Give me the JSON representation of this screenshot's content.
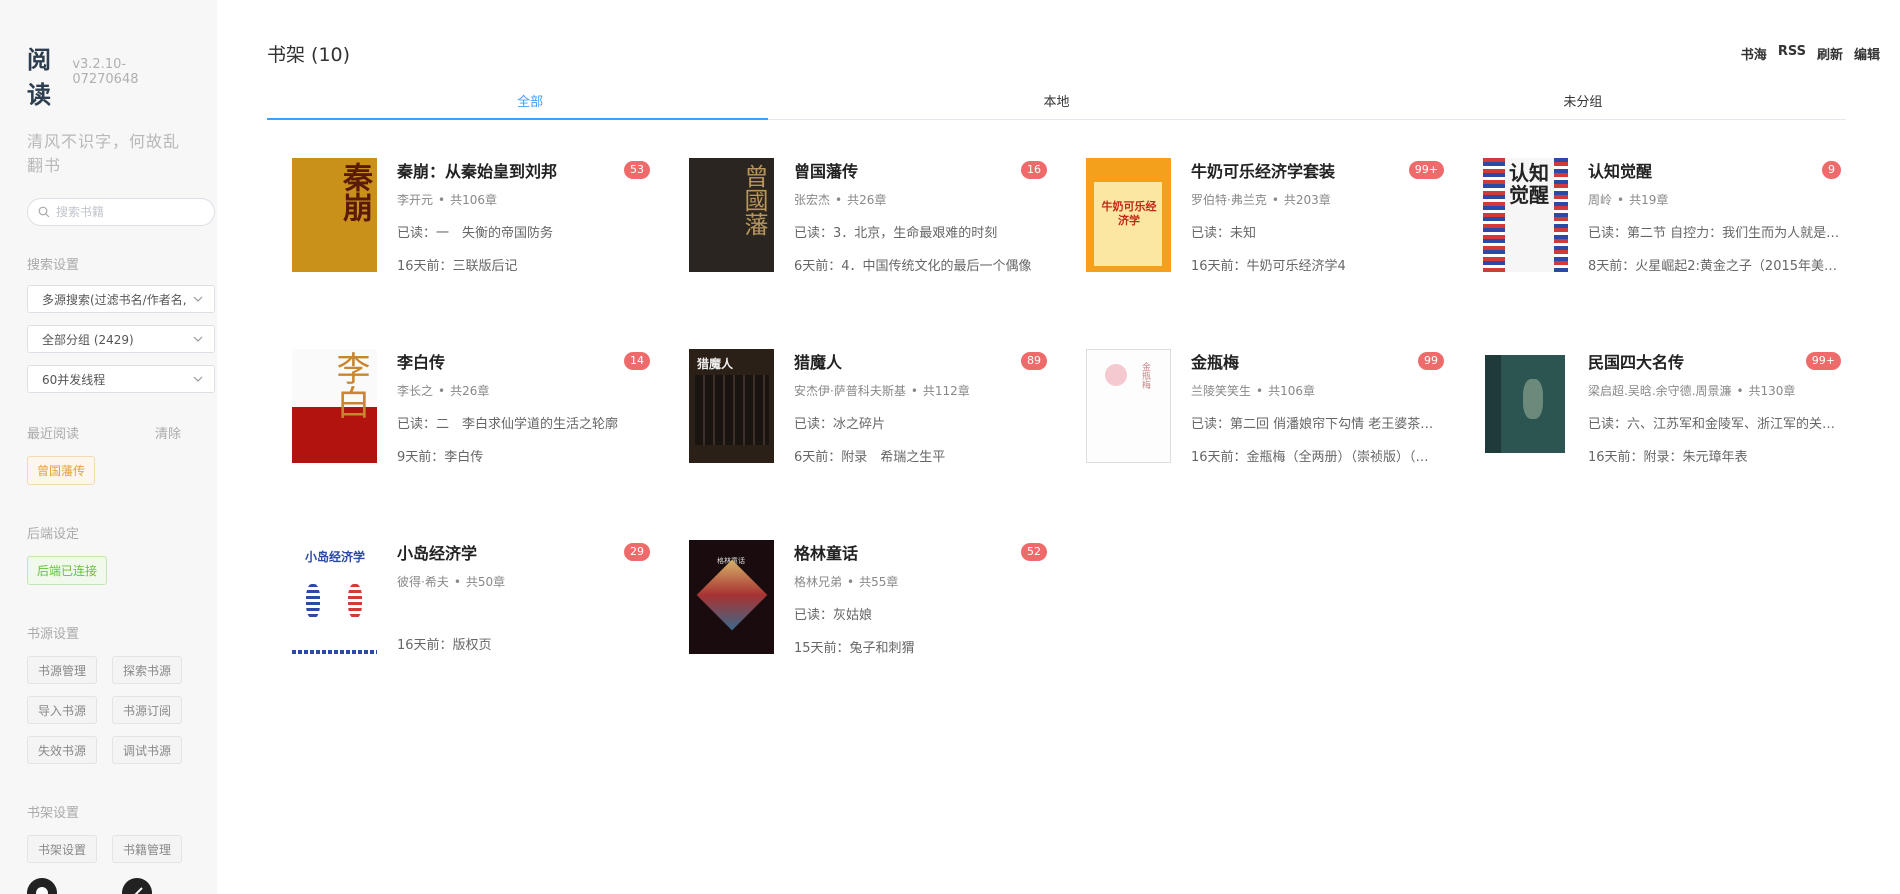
{
  "sidebar": {
    "app_name": "阅读",
    "version": "v3.2.10-07270648",
    "slogan": "清风不识字，何故乱翻书",
    "search_placeholder": "搜索书籍",
    "search_settings_title": "搜索设置",
    "selects": [
      "多源搜索(过滤书名/作者名,",
      "全部分组 (2429)",
      "60并发线程"
    ],
    "recent_title": "最近阅读",
    "recent_clear": "清除",
    "recent_book": "曾国藩传",
    "backend_title": "后端设定",
    "backend_status": "后端已连接",
    "source_title": "书源设置",
    "source_buttons": [
      "书源管理",
      "探索书源",
      "导入书源",
      "书源订阅",
      "失效书源",
      "调试书源"
    ],
    "shelf_settings_title": "书架设置",
    "shelf_buttons": [
      "书架设置",
      "书籍管理"
    ]
  },
  "main": {
    "shelf_title": "书架 (10)",
    "actions": [
      "书海",
      "RSS",
      "刷新",
      "编辑"
    ],
    "tabs": [
      "全部",
      "本地",
      "未分组"
    ],
    "active_tab": 0
  },
  "books": [
    {
      "title": "秦崩：从秦始皇到刘邦",
      "badge": "53",
      "author": "李开元",
      "chapters": "共106章",
      "read": "已读：一　失衡的帝国防务",
      "latest": "16天前：三联版后记",
      "cover_text": "秦崩"
    },
    {
      "title": "曾国藩传",
      "badge": "16",
      "author": "张宏杰",
      "chapters": "共26章",
      "read": "已读：3．北京，生命最艰难的时刻",
      "latest": "6天前：4．中国传统文化的最后一个偶像",
      "cover_text": "曾國藩"
    },
    {
      "title": "牛奶可乐经济学套装",
      "badge": "99+",
      "author": "罗伯特·弗兰克",
      "chapters": "共203章",
      "read": "已读：未知",
      "latest": "16天前：牛奶可乐经济学4",
      "cover_text": "牛奶可乐经济学"
    },
    {
      "title": "认知觉醒",
      "badge": "9",
      "author": "周岭",
      "chapters": "共19章",
      "read": "已读：第二节 自控力：我们生而为人就是…",
      "latest": "8天前：火星崛起2:黄金之子（2015年美国…",
      "cover_text": "认知觉醒"
    },
    {
      "title": "李白传",
      "badge": "14",
      "author": "李长之",
      "chapters": "共26章",
      "read": "已读：二　李白求仙学道的生活之轮廓",
      "latest": "9天前：李白传",
      "cover_text": "李白"
    },
    {
      "title": "猎魔人",
      "badge": "89",
      "author": "安杰伊·萨普科夫斯基",
      "chapters": "共112章",
      "read": "已读：冰之碎片",
      "latest": "6天前：附录　希瑞之生平",
      "cover_text": "猎魔人"
    },
    {
      "title": "金瓶梅",
      "badge": "99",
      "author": "兰陵笑笑生",
      "chapters": "共106章",
      "read": "已读：第二回 俏潘娘帘下勾情 老王婆茶坊…",
      "latest": "16天前：金瓶梅（全两册）（崇祯版）（…",
      "cover_text": "金瓶梅"
    },
    {
      "title": "民国四大名传",
      "badge": "99+",
      "author": "梁启超.吴晗.余守德.周景濂",
      "chapters": "共130章",
      "read": "已读：六、江苏军和金陵军、浙江军的关…",
      "latest": "16天前：附录：朱元璋年表",
      "cover_text": ""
    },
    {
      "title": "小岛经济学",
      "badge": "29",
      "author": "彼得·希夫",
      "chapters": "共50章",
      "read": "",
      "latest": "16天前：版权页",
      "cover_text": "小岛经济学"
    },
    {
      "title": "格林童话",
      "badge": "52",
      "author": "格林兄弟",
      "chapters": "共55章",
      "read": "已读：灰姑娘",
      "latest": "15天前：兔子和刺猬",
      "cover_text": "格林童话"
    }
  ],
  "colors": {
    "accent": "#409eff",
    "badge": "#ef6b6b",
    "sidebar_bg": "#f7f7f7"
  }
}
